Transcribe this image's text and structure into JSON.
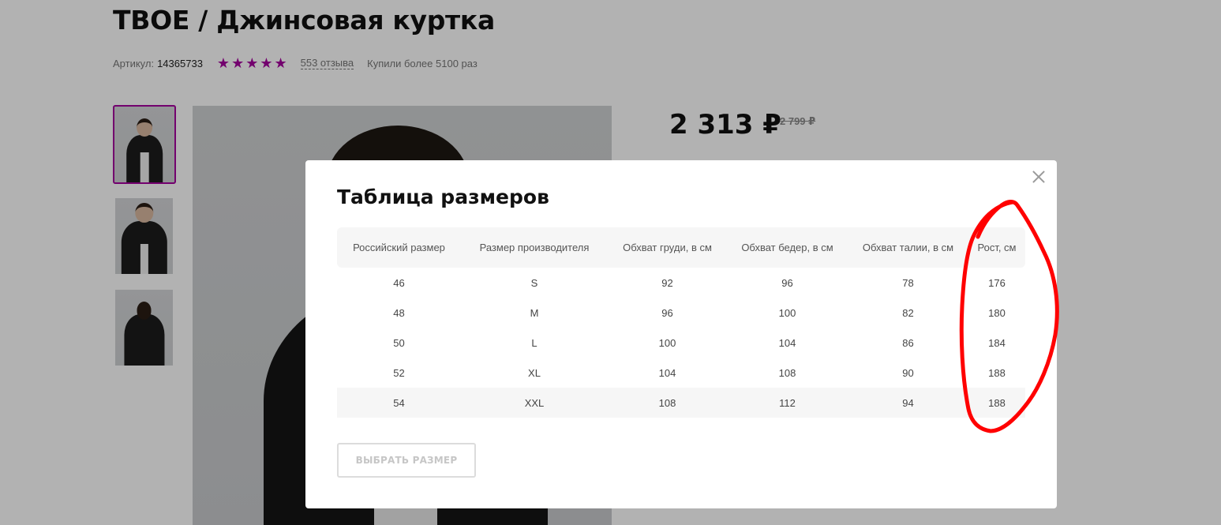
{
  "product": {
    "title": "ТВОЕ / Джинсовая куртка",
    "sku_label": "Артикул:",
    "sku_value": "14365733",
    "rating_stars": 5,
    "reviews_label": "553 отзыва",
    "bought_label": "Купили более 5100 раз",
    "price_current": "2 313 ₽",
    "price_old": "2 799 ₽"
  },
  "colors": {
    "accent": "#a5009e",
    "annotation": "#ff0000"
  },
  "modal": {
    "title": "Таблица размеров",
    "headers": [
      "Российский размер",
      "Размер производителя",
      "Обхват груди, в см",
      "Обхват бедер, в см",
      "Обхват талии, в см",
      "Рост, см"
    ],
    "rows": [
      [
        "46",
        "S",
        "92",
        "96",
        "78",
        "176"
      ],
      [
        "48",
        "M",
        "96",
        "100",
        "82",
        "180"
      ],
      [
        "50",
        "L",
        "100",
        "104",
        "86",
        "184"
      ],
      [
        "52",
        "XL",
        "104",
        "108",
        "90",
        "188"
      ],
      [
        "54",
        "XXL",
        "108",
        "112",
        "94",
        "188"
      ]
    ],
    "choose_button_label": "ВЫБРАТЬ РАЗМЕР"
  }
}
